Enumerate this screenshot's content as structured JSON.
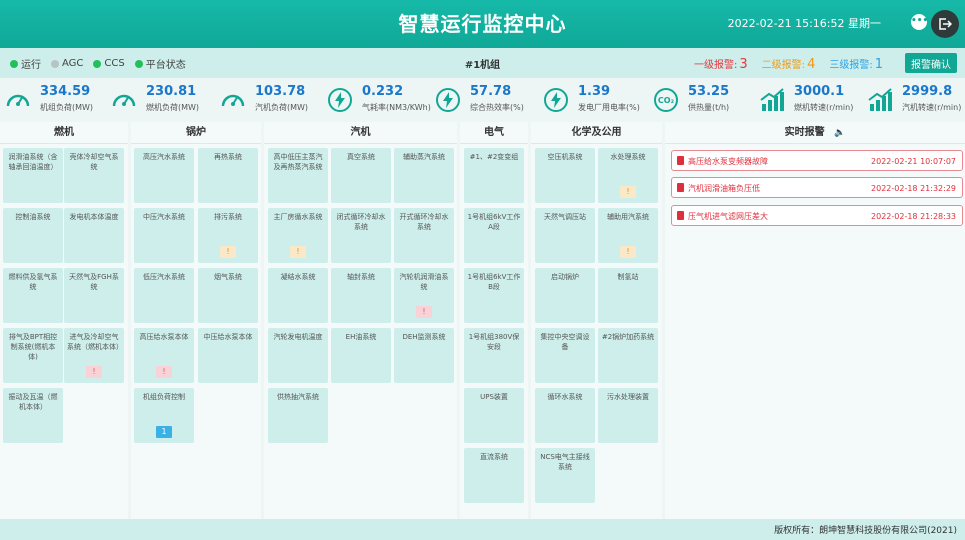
{
  "header": {
    "title": "智慧运行监控中心",
    "datetime": "2022-02-21 15:16:52 星期一",
    "more_glyph": "•••",
    "exit_glyph": "⇥"
  },
  "status_bar": {
    "legend": [
      {
        "label": "运行",
        "color": "#22c05a"
      },
      {
        "label": "AGC",
        "color": "#b9c4c2"
      },
      {
        "label": "CCS",
        "color": "#22c05a"
      },
      {
        "label": "平台状态",
        "color": "#22c05a"
      }
    ],
    "unit": "#1机组",
    "alarm_level1": {
      "label": "一级报警:",
      "count": "3",
      "color": "#e8363f"
    },
    "alarm_level2": {
      "label": "二级报警:",
      "count": "4",
      "color": "#ef9a1c"
    },
    "alarm_level3": {
      "label": "三级报警:",
      "count": "1",
      "color": "#2ea3e6"
    },
    "confirm_label": "报警确认"
  },
  "metrics": [
    {
      "value": "334.59",
      "label": "机组负荷(MW)",
      "icon": "gauge-icon"
    },
    {
      "value": "230.81",
      "label": "燃机负荷(MW)",
      "icon": "gauge-icon"
    },
    {
      "value": "103.78",
      "label": "汽机负荷(MW)",
      "icon": "gauge-icon"
    },
    {
      "value": "0.232",
      "label": "气耗率(NM3/KWh)",
      "icon": "bolt-icon"
    },
    {
      "value": "57.78",
      "label": "综合热效率(%)",
      "icon": "bolt-icon"
    },
    {
      "value": "1.39",
      "label": "发电厂用电率(%)",
      "icon": "bolt-icon"
    },
    {
      "value": "53.25",
      "label": "供热量(t/h)",
      "icon": "co2-icon"
    },
    {
      "value": "3000.1",
      "label": "燃机转速(r/min)",
      "icon": "bars-icon"
    },
    {
      "value": "2999.8",
      "label": "汽机转速(r/min)",
      "icon": "bars-icon"
    }
  ],
  "columns": {
    "gas_turbine": {
      "title": "燃机",
      "cards": [
        "润滑油系统（含轴承回油温度）",
        "壳体冷却空气系统",
        "控制油系统",
        "发电机本体温度",
        "燃料供及氢气系统",
        "天然气及FGH系统",
        "排气及BPT相控制系统(燃机本体)",
        "进气及冷却空气系统（燃机本体）",
        "振动及瓦温（燃机本体）"
      ]
    },
    "boiler": {
      "title": "锅炉",
      "cards": [
        "高压汽水系统",
        "再热系统",
        "中压汽水系统",
        "排污系统",
        "低压汽水系统",
        "烟气系统",
        "高压给水泵本体",
        "中压给水泵本体",
        "机组负荷控制"
      ]
    },
    "steam_turbine": {
      "title": "汽机",
      "cards": [
        "高中低压主蒸汽及再热蒸汽系统",
        "真空系统",
        "辅助蒸汽系统",
        "主厂房循水系统",
        "闭式循环冷却水系统",
        "开式循环冷却水系统",
        "凝结水系统",
        "轴封系统",
        "汽轮机润滑油系统",
        "汽轮发电机温度",
        "EH油系统",
        "DEH监测系统",
        "供热抽汽系统"
      ]
    },
    "electrical": {
      "title": "电气",
      "cards": [
        "#1、#2变变组",
        "1号机组6kV工作A段",
        "1号机组6kV工作B段",
        "1号机组380V保安段",
        "UPS装置",
        "直流系统"
      ]
    },
    "chemical": {
      "title": "化学及公用",
      "cards": [
        "空压机系统",
        "水处理系统",
        "天然气调压站",
        "辅助用汽系统",
        "启动锅炉",
        "制氢站",
        "集控中央空调设备",
        "#2锅炉加药系统",
        "循环水系统",
        "污水处理装置",
        "NCS电气主接线系统"
      ]
    },
    "realtime_alarm": {
      "title": "实时报警",
      "sound_glyph": "🔈"
    }
  },
  "badges": {
    "yellow": "!",
    "pink": "!",
    "blue": "1"
  },
  "alarms": [
    {
      "message": "高压给水泵变频器故障",
      "time": "2022-02-21 10:07:07"
    },
    {
      "message": "汽机润滑油箱负压低",
      "time": "2022-02-18 21:32:29"
    },
    {
      "message": "压气机进气滤网压差大",
      "time": "2022-02-18 21:28:33"
    }
  ],
  "footer": {
    "copyright": "版权所有：朗坤智慧科技股份有限公司(2021)"
  }
}
